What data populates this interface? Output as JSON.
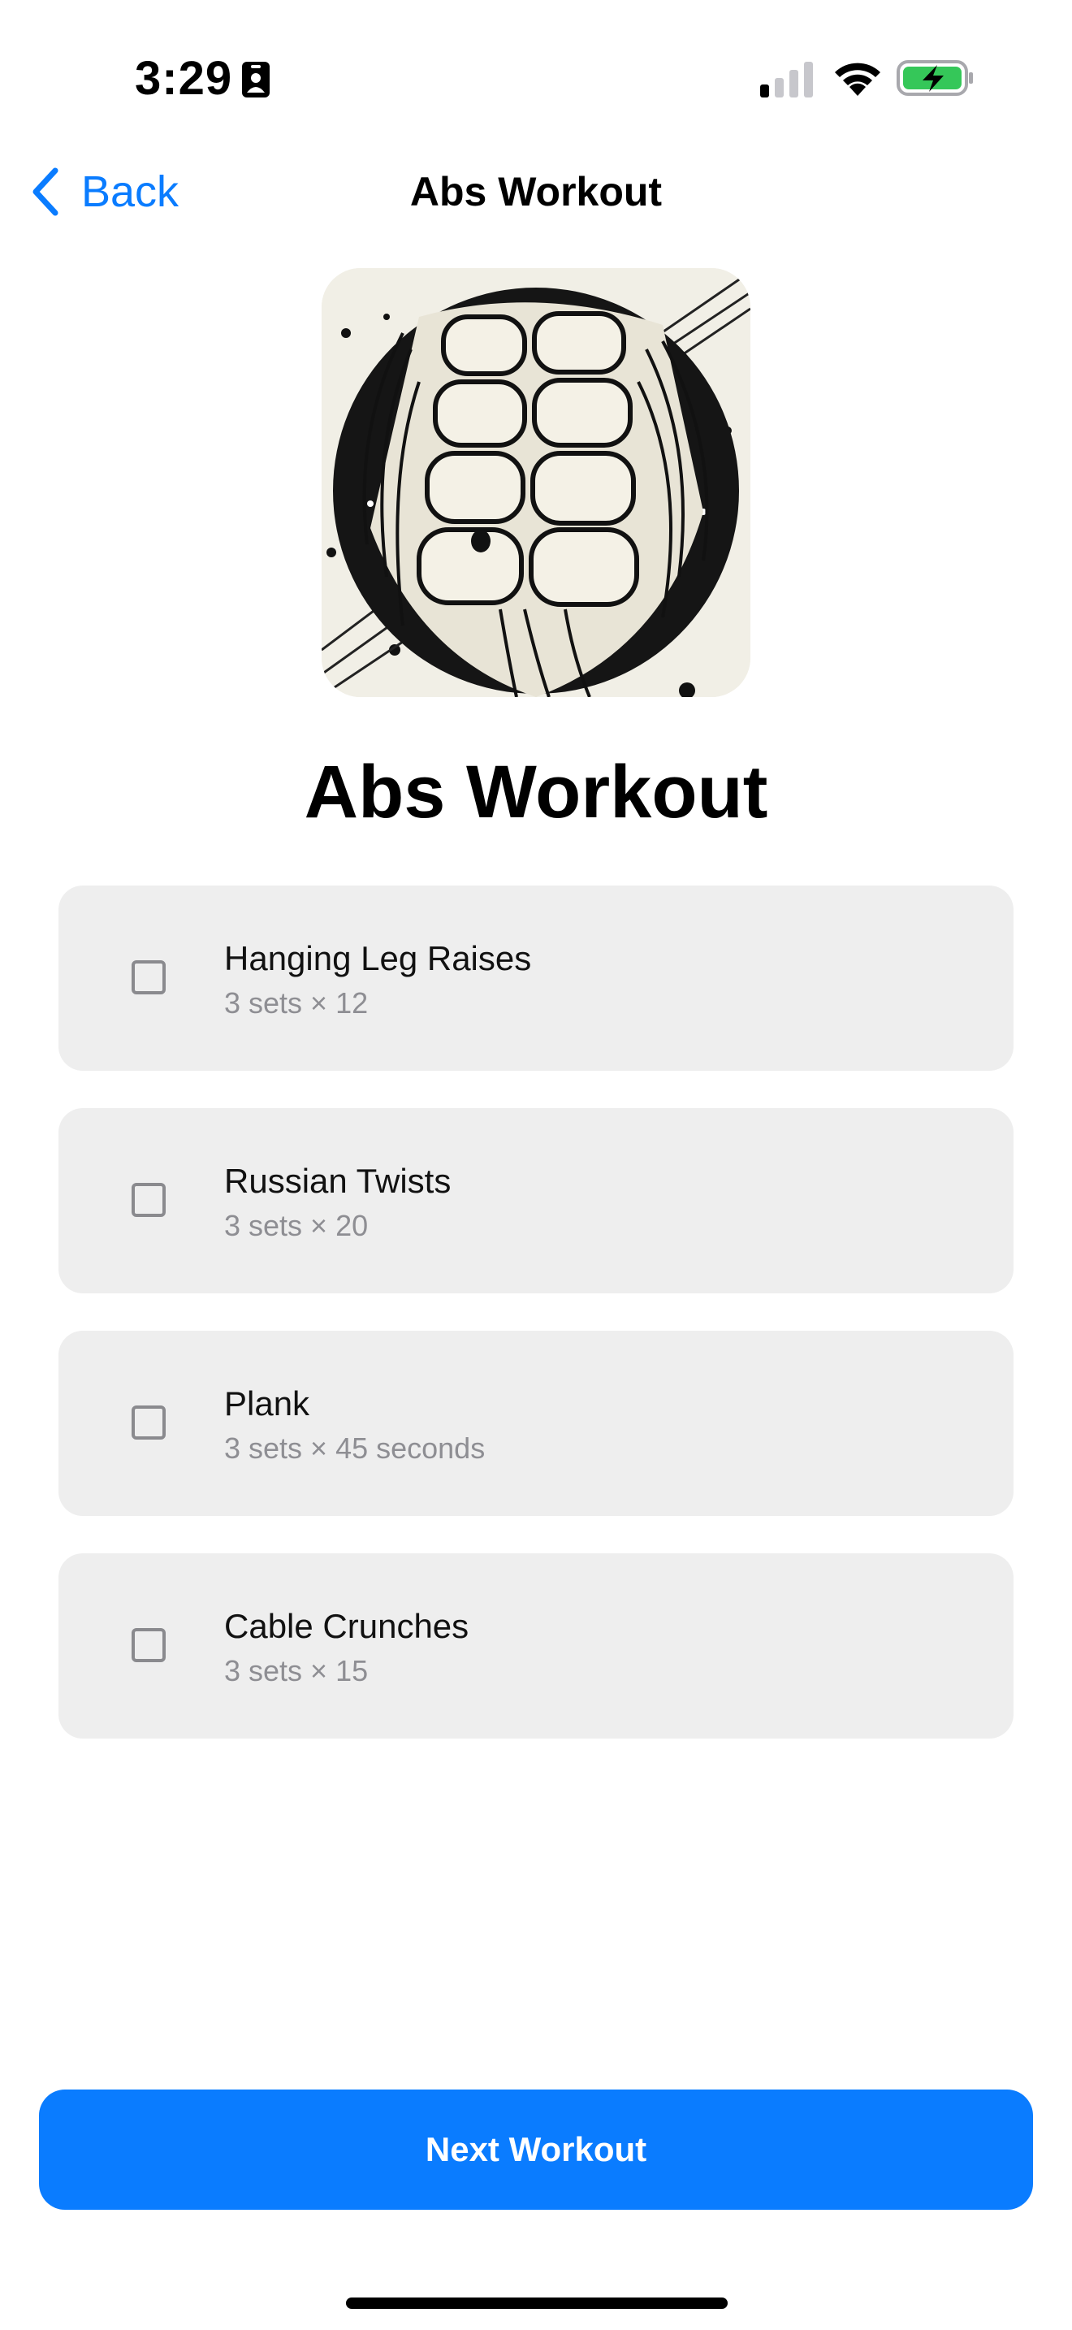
{
  "status_bar": {
    "time": "3:29",
    "badge_icon": "contact-card-icon",
    "signal_icon": "cellular-signal-icon",
    "wifi_icon": "wifi-icon",
    "battery_icon": "battery-charging-icon",
    "battery_color": "#35c759"
  },
  "nav": {
    "back_label": "Back",
    "back_icon": "chevron-left-icon",
    "title": "Abs Workout"
  },
  "hero": {
    "image_subject": "abdominal-muscles-illustration"
  },
  "page": {
    "title": "Abs Workout"
  },
  "exercises": [
    {
      "name": "Hanging Leg Raises",
      "detail": "3 sets × 12",
      "checked": false
    },
    {
      "name": "Russian Twists",
      "detail": "3 sets × 20",
      "checked": false
    },
    {
      "name": "Plank",
      "detail": "3 sets × 45 seconds",
      "checked": false
    },
    {
      "name": "Cable Crunches",
      "detail": "3 sets × 15",
      "checked": false
    }
  ],
  "actions": {
    "next_label": "Next Workout"
  },
  "colors": {
    "accent": "#0a7cff",
    "card_background": "#eeeeee",
    "secondary_text": "#8e8e93"
  }
}
